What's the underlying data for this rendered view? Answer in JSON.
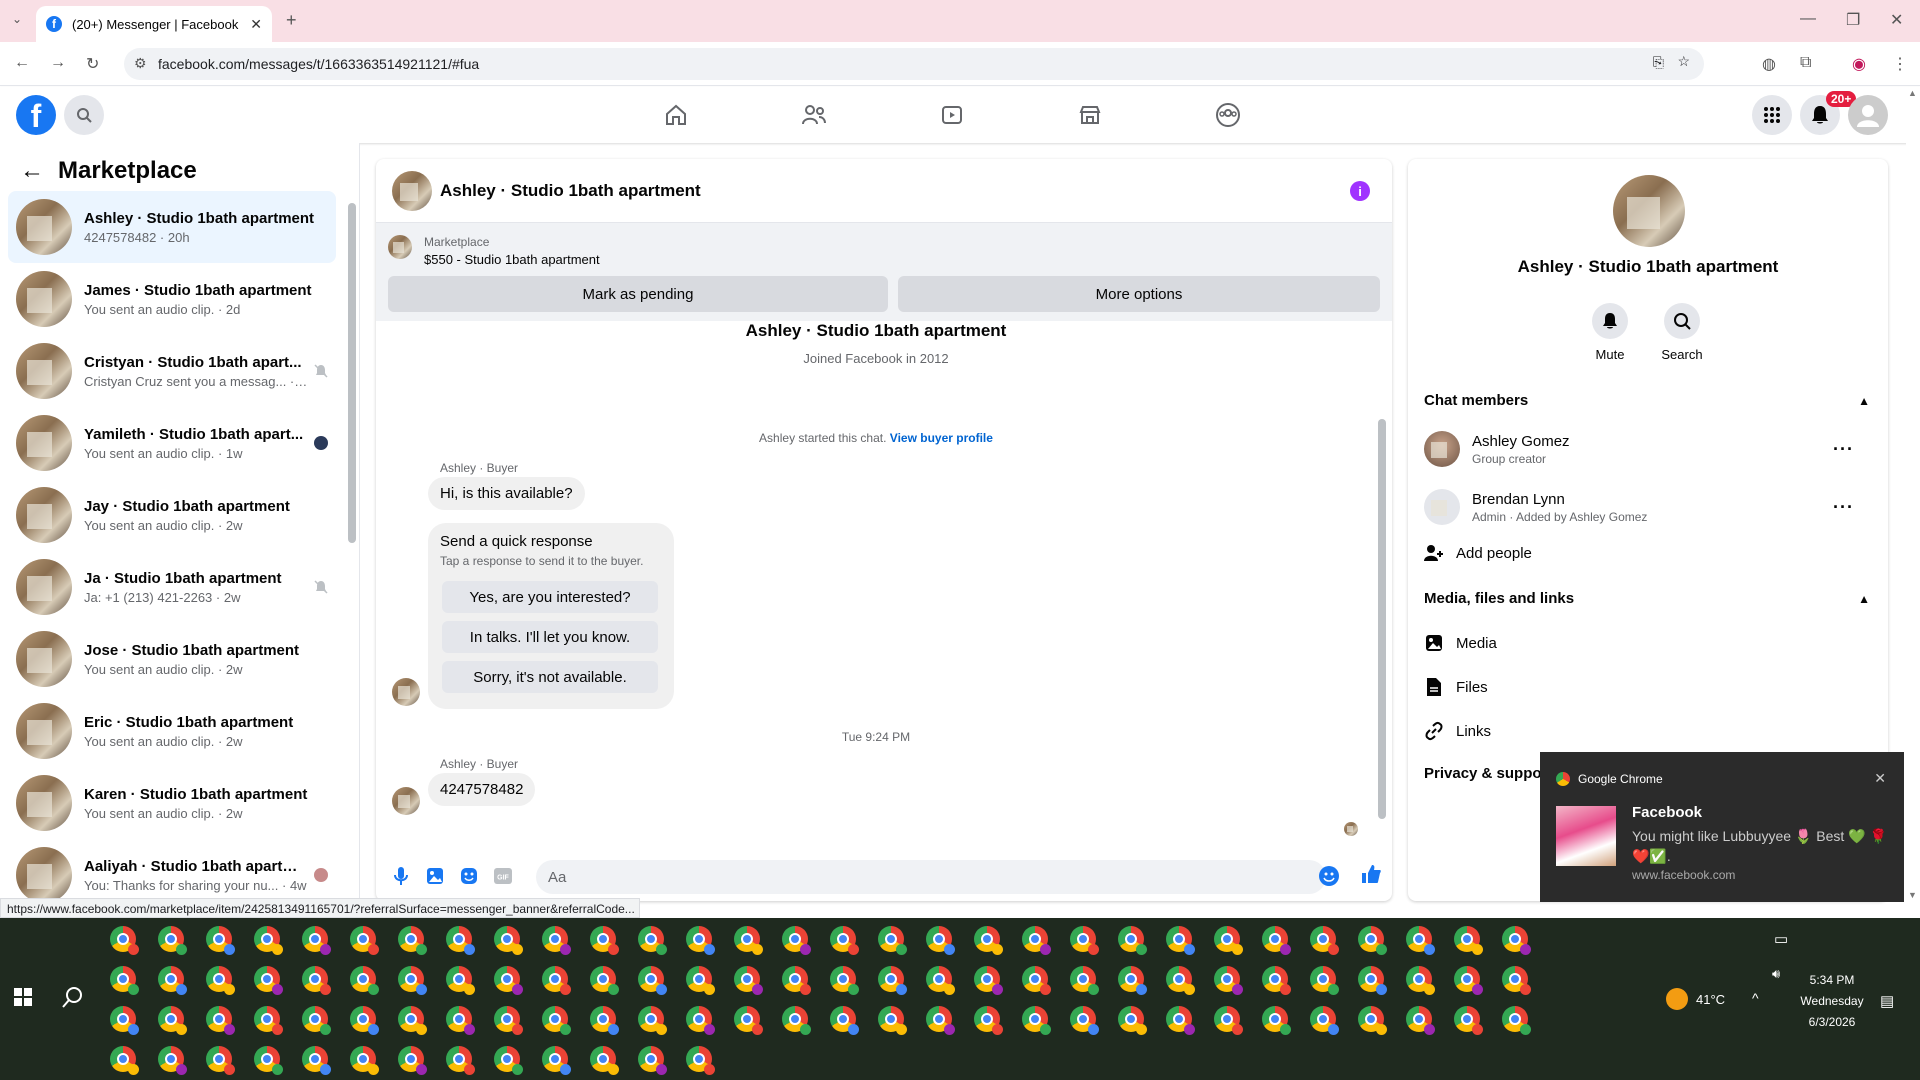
{
  "browser": {
    "tab_title": "(20+) Messenger | Facebook",
    "url": "facebook.com/messages/t/1663363514921121/#fua",
    "status_url": "https://www.facebook.com/marketplace/item/2425813491165701/?referralSurface=messenger_banner&referralCode..."
  },
  "fbnav": {
    "notification_badge": "20+"
  },
  "sidebar": {
    "title": "Marketplace",
    "conversations": [
      {
        "name": "Ashley · Studio 1bath apartment",
        "sub": "4247578482 · 20h"
      },
      {
        "name": "James · Studio 1bath apartment",
        "sub": "You sent an audio clip. · 2d"
      },
      {
        "name": "Cristyan · Studio 1bath apart...",
        "sub": "Cristyan Cruz sent you a messag... · 1w"
      },
      {
        "name": "Yamileth · Studio 1bath apart...",
        "sub": "You sent an audio clip. · 1w"
      },
      {
        "name": "Jay · Studio 1bath apartment",
        "sub": "You sent an audio clip. · 2w"
      },
      {
        "name": "Ja · Studio 1bath apartment",
        "sub": "Ja: +1 (213) 421-2263 · 2w"
      },
      {
        "name": "Jose · Studio 1bath apartment",
        "sub": "You sent an audio clip. · 2w"
      },
      {
        "name": "Eric · Studio 1bath apartment",
        "sub": "You sent an audio clip. · 2w"
      },
      {
        "name": "Karen · Studio 1bath apartment",
        "sub": "You sent an audio clip. · 2w"
      },
      {
        "name": "Aaliyah · Studio 1bath apartm...",
        "sub": "You: Thanks for sharing your nu... · 4w"
      }
    ]
  },
  "chat": {
    "header_title": "Ashley · Studio 1bath apartment",
    "banner_label": "Marketplace",
    "banner_listing": "$550 - Studio 1bath apartment",
    "mark_pending": "Mark as pending",
    "more_options": "More options",
    "profile_name": "Ashley · Studio 1bath apartment",
    "joined": "Joined Facebook in 2012",
    "started_text": "Ashley started this chat.",
    "view_buyer_profile": "View buyer profile",
    "sender_label_1": "Ashley · Buyer",
    "msg_1": "Hi, is this available?",
    "quick_title": "Send a quick response",
    "quick_sub": "Tap a response to send it to the buyer.",
    "quick_1": "Yes, are you interested?",
    "quick_2": "In talks. I'll let you know.",
    "quick_3": "Sorry, it's not available.",
    "timestamp": "Tue 9:24 PM",
    "sender_label_2": "Ashley · Buyer",
    "msg_2": "4247578482",
    "input_placeholder": "Aa"
  },
  "info_panel": {
    "name": "Ashley · Studio 1bath apartment",
    "mute": "Mute",
    "search": "Search",
    "chat_members": "Chat members",
    "members": [
      {
        "name": "Ashley Gomez",
        "role": "Group creator"
      },
      {
        "name": "Brendan Lynn",
        "role": "Admin · Added by Ashley Gomez"
      }
    ],
    "add_people": "Add people",
    "media_section": "Media, files and links",
    "media": "Media",
    "files": "Files",
    "links": "Links",
    "privacy": "Privacy & support"
  },
  "notification": {
    "app": "Google Chrome",
    "title": "Facebook",
    "body": "You might like Lubbuyyee 🌷 Best 💚 🌹❤️✅.",
    "source": "www.facebook.com"
  },
  "taskbar": {
    "temp": "41°C",
    "time": "5:34 PM",
    "day": "Wednesday",
    "date": "6/3/2026"
  },
  "colors": {
    "fb_blue": "#1877f2",
    "tab_bg": "#f9dfe5",
    "taskbar": "#1f2a1f"
  }
}
